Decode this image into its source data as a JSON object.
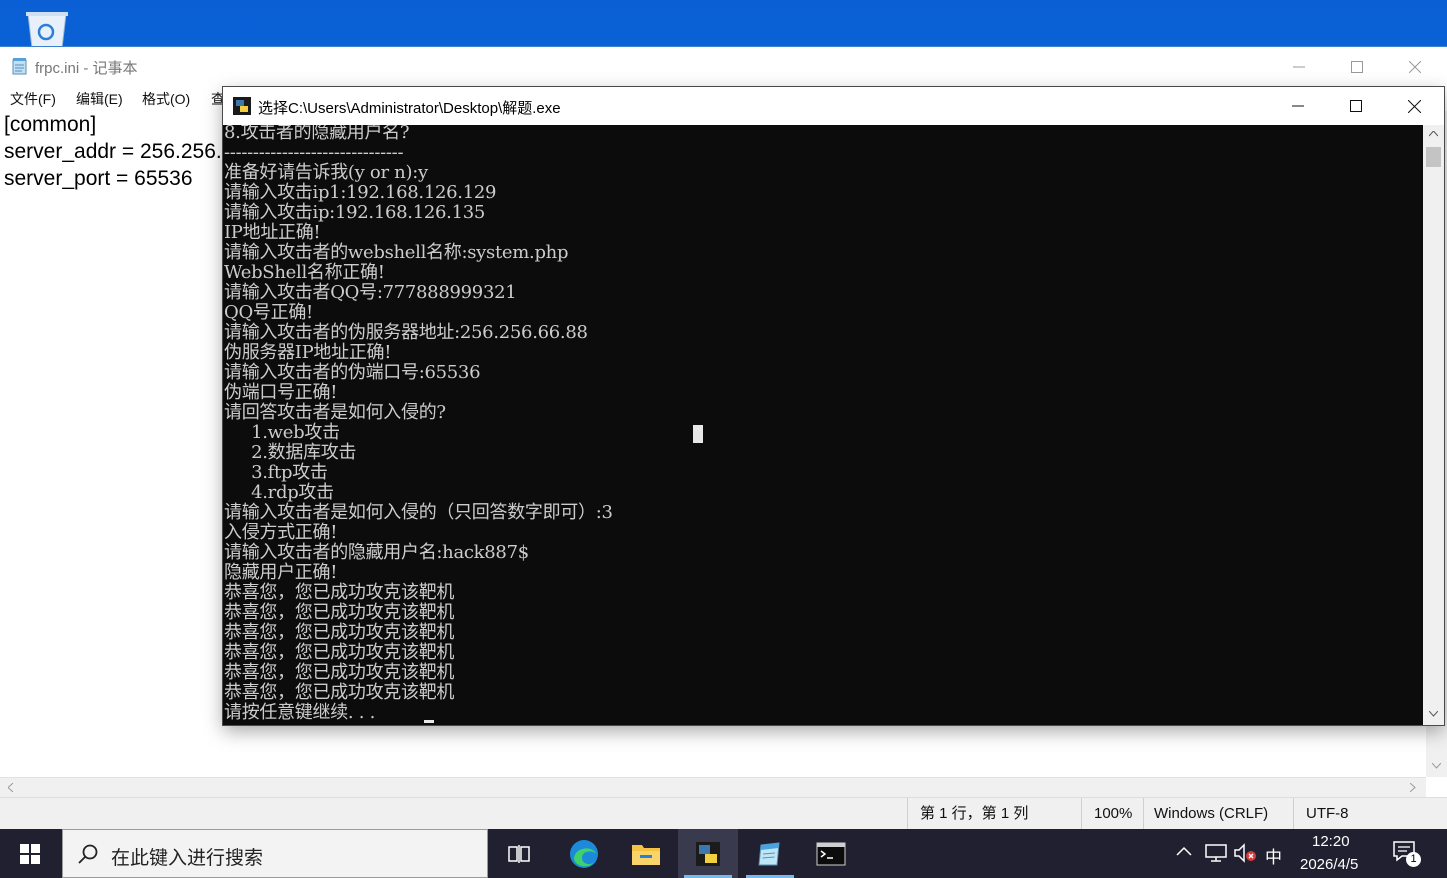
{
  "notepad": {
    "title": "frpc.ini - 记事本",
    "menu": [
      "文件(F)",
      "编辑(E)",
      "格式(O)",
      "查"
    ],
    "content_lines": [
      "[common]",
      "server_addr = 256.256.",
      "server_port = 65536"
    ],
    "status": {
      "position": "第 1 行，第 1 列",
      "zoom": "100%",
      "line_ending": "Windows (CRLF)",
      "encoding": "UTF-8"
    }
  },
  "console": {
    "title": "选择C:\\Users\\Administrator\\Desktop\\解题.exe",
    "lines": [
      "8.攻击者的隐藏用户名?",
      "-------------------------------",
      "准备好请告诉我(y or n):y",
      "请输入攻击ip1:192.168.126.129",
      "请输入攻击ip:192.168.126.135",
      "IP地址正确!",
      "请输入攻击者的webshell名称:system.php",
      "WebShell名称正确!",
      "请输入攻击者QQ号:777888999321",
      "QQ号正确!",
      "请输入攻击者的伪服务器地址:256.256.66.88",
      "伪服务器IP地址正确!",
      "请输入攻击者的伪端口号:65536",
      "伪端口号正确!",
      "请回答攻击者是如何入侵的?",
      "     1.web攻击",
      "     2.数据库攻击",
      "     3.ftp攻击",
      "     4.rdp攻击",
      "请输入攻击者是如何入侵的（只回答数字即可）:3",
      "入侵方式正确!",
      "请输入攻击者的隐藏用户名:hack887$",
      "隐藏用户正确!",
      "恭喜您，您已成功攻克该靶机",
      "恭喜您，您已成功攻克该靶机",
      "恭喜您，您已成功攻克该靶机",
      "恭喜您，您已成功攻克该靶机",
      "恭喜您，您已成功攻克该靶机",
      "恭喜您，您已成功攻克该靶机",
      "请按任意键继续. . ."
    ]
  },
  "taskbar": {
    "search_placeholder": "在此键入进行搜索",
    "apps": [
      "task-view-icon",
      "edge-icon",
      "file-explorer-icon",
      "python-exe-icon",
      "notepad-icon",
      "terminal-icon"
    ],
    "ime": "中",
    "time": "12:20",
    "date": "2026/4/5",
    "notification_count": "1"
  },
  "colors": {
    "console_bg": "#0c0c0c",
    "console_text": "#cccccc",
    "taskbar_bg": "#202030",
    "desktop_blue": "#0f74e6"
  }
}
